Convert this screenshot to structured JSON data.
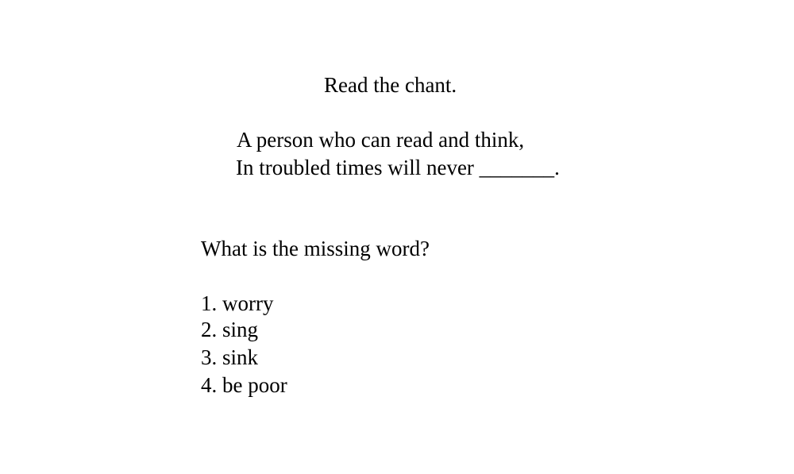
{
  "instruction": "Read the chant.",
  "chant": {
    "line1": "A person who can read and think,",
    "line2": "In troubled times will never _______."
  },
  "question": "What is the missing word?",
  "options": [
    "1. worry",
    "2. sing",
    "3. sink",
    "4. be poor"
  ]
}
